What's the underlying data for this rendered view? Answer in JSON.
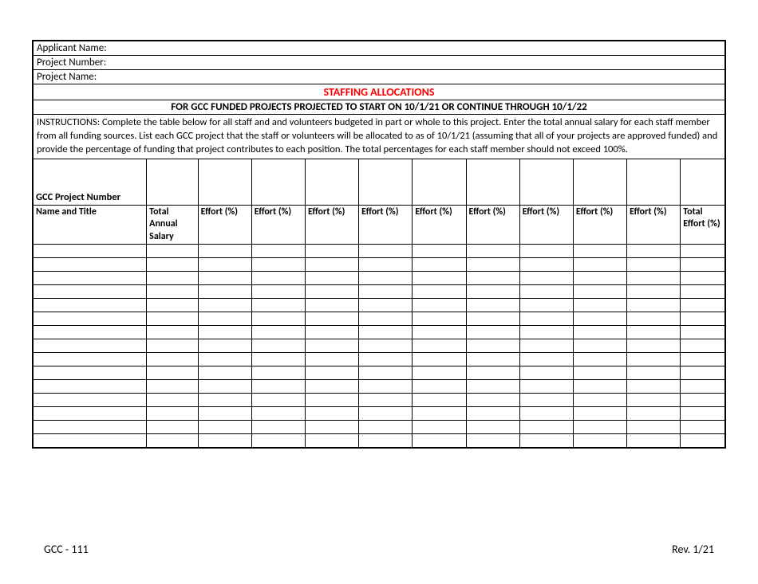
{
  "fields": {
    "applicant_name_label": "Applicant Name:",
    "project_number_label": "Project Number:",
    "project_name_label": "Project Name:"
  },
  "title": "STAFFING  ALLOCATIONS",
  "subtitle": "FOR GCC FUNDED PROJECTS PROJECTED TO START ON 10/1/21 OR CONTINUE THROUGH 10/1/22",
  "instructions": "INSTRUCTIONS: Complete the table below for all staff and and volunteers budgeted in part or whole to this project.  Enter the total annual salary for each staff member from all funding sources.  List each GCC project that the staff or volunteers will be allocated to as of 10/1/21 (assuming that all of your projects are approved funded) and provide the percentage of funding that project contributes to each position.  The total percentages for each staff member should not exceed 100%.",
  "gcc_header": "GCC Project Number",
  "columns": {
    "name_title": "Name and Title",
    "salary": "Total Annual Salary",
    "effort": "Effort (%)",
    "total_effort": "Total Effort (%)"
  },
  "effort_column_count": 9,
  "data_row_count": 15,
  "footer": {
    "left": "GCC - 111",
    "right": "Rev. 1/21"
  }
}
